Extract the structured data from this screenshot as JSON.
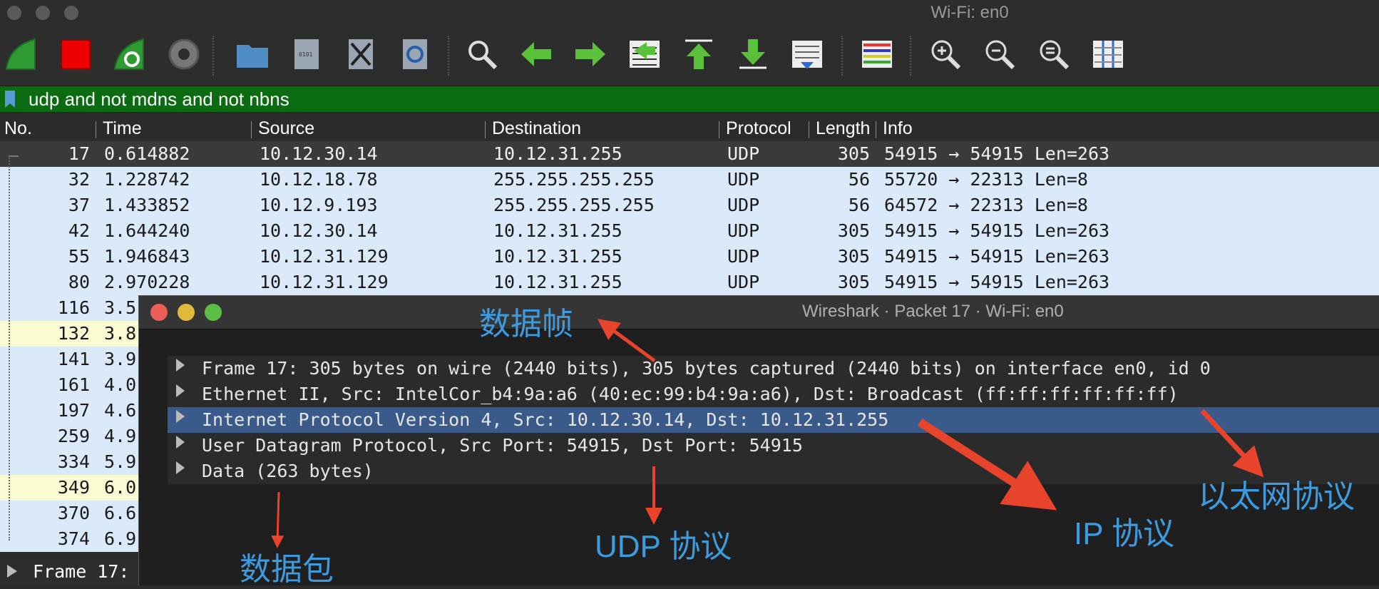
{
  "window": {
    "title": "Wi-Fi: en0"
  },
  "toolbar": {
    "icons": [
      "start-capture-icon",
      "stop-capture-icon",
      "restart-capture-icon",
      "capture-options-icon",
      "open-file-icon",
      "save-file-icon",
      "close-file-icon",
      "reload-file-icon",
      "find-packet-icon",
      "go-back-icon",
      "go-forward-icon",
      "go-to-packet-icon",
      "go-first-icon",
      "go-last-icon",
      "auto-scroll-icon",
      "colorize-icon",
      "zoom-in-icon",
      "zoom-out-icon",
      "normal-size-icon",
      "resize-columns-icon"
    ]
  },
  "filter": {
    "value": "udp and not mdns and not nbns"
  },
  "columns": [
    "No.",
    "Time",
    "Source",
    "Destination",
    "Protocol",
    "Length",
    "Info"
  ],
  "packets": [
    {
      "no": "17",
      "time": "0.614882",
      "src": "10.12.30.14",
      "dst": "10.12.31.255",
      "proto": "UDP",
      "len": "305",
      "info": "54915 → 54915 Len=263",
      "style": "sel"
    },
    {
      "no": "32",
      "time": "1.228742",
      "src": "10.12.18.78",
      "dst": "255.255.255.255",
      "proto": "UDP",
      "len": "56",
      "info": "55720 → 22313 Len=8",
      "style": "blue"
    },
    {
      "no": "37",
      "time": "1.433852",
      "src": "10.12.9.193",
      "dst": "255.255.255.255",
      "proto": "UDP",
      "len": "56",
      "info": "64572 → 22313 Len=8",
      "style": "blue"
    },
    {
      "no": "42",
      "time": "1.644240",
      "src": "10.12.30.14",
      "dst": "10.12.31.255",
      "proto": "UDP",
      "len": "305",
      "info": "54915 → 54915 Len=263",
      "style": "blue"
    },
    {
      "no": "55",
      "time": "1.946843",
      "src": "10.12.31.129",
      "dst": "10.12.31.255",
      "proto": "UDP",
      "len": "305",
      "info": "54915 → 54915 Len=263",
      "style": "blue"
    },
    {
      "no": "80",
      "time": "2.970228",
      "src": "10.12.31.129",
      "dst": "10.12.31.255",
      "proto": "UDP",
      "len": "305",
      "info": "54915 → 54915 Len=263",
      "style": "blue"
    },
    {
      "no": "116",
      "time": "3.5",
      "src": "",
      "dst": "",
      "proto": "",
      "len": "",
      "info": "",
      "style": "blue"
    },
    {
      "no": "132",
      "time": "3.8",
      "src": "",
      "dst": "",
      "proto": "",
      "len": "",
      "info": "",
      "style": "yellow"
    },
    {
      "no": "141",
      "time": "3.9",
      "src": "",
      "dst": "",
      "proto": "",
      "len": "",
      "info": "",
      "style": "blue"
    },
    {
      "no": "161",
      "time": "4.0",
      "src": "",
      "dst": "",
      "proto": "",
      "len": "",
      "info": "",
      "style": "blue"
    },
    {
      "no": "197",
      "time": "4.6",
      "src": "",
      "dst": "",
      "proto": "",
      "len": "",
      "info": "",
      "style": "blue"
    },
    {
      "no": "259",
      "time": "4.9",
      "src": "",
      "dst": "",
      "proto": "",
      "len": "",
      "info": "",
      "style": "blue"
    },
    {
      "no": "334",
      "time": "5.9",
      "src": "",
      "dst": "",
      "proto": "",
      "len": "",
      "info": "",
      "style": "blue"
    },
    {
      "no": "349",
      "time": "6.0",
      "src": "",
      "dst": "",
      "proto": "",
      "len": "",
      "info": "",
      "style": "yellow"
    },
    {
      "no": "370",
      "time": "6.6",
      "src": "",
      "dst": "",
      "proto": "",
      "len": "",
      "info": "",
      "style": "blue"
    },
    {
      "no": "374",
      "time": "6.9",
      "src": "",
      "dst": "",
      "proto": "",
      "len": "",
      "info": "",
      "style": "blue"
    }
  ],
  "status": {
    "text": "Frame 17:"
  },
  "dialog": {
    "title": "Wireshark · Packet 17 · Wi-Fi: en0",
    "tree": [
      "Frame 17: 305 bytes on wire (2440 bits), 305 bytes captured (2440 bits) on interface en0, id 0",
      "Ethernet II, Src: IntelCor_b4:9a:a6 (40:ec:99:b4:9a:a6), Dst: Broadcast (ff:ff:ff:ff:ff:ff)",
      "Internet Protocol Version 4, Src: 10.12.30.14, Dst: 10.12.31.255",
      "User Datagram Protocol, Src Port: 54915, Dst Port: 54915",
      "Data (263 bytes)"
    ],
    "selected_index": 2
  },
  "annotations": {
    "frame": "数据帧",
    "packet": "数据包",
    "udp": "UDP 协议",
    "ip": "IP 协议",
    "ethernet": "以太网协议"
  },
  "colors": {
    "annotation": "#3d9be0",
    "arrow": "#e8432b",
    "filter_bg": "#0a6b11",
    "row_blue": "#dbeafb",
    "row_yellow": "#fbfbd3",
    "tree_selected": "#3a5a8a"
  }
}
